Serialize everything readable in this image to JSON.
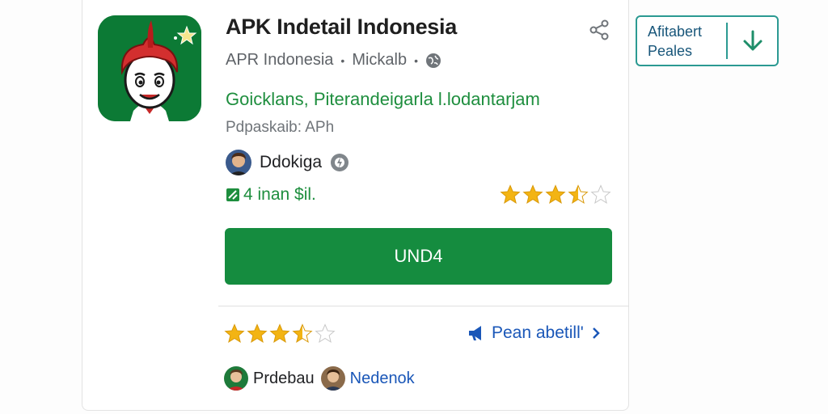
{
  "app": {
    "title": "APK Indetail Indonesia",
    "developer": "APR Indonesia",
    "developer_location": "Mickalb",
    "category": "Goicklans, Piterandeigarla l.lodantarjam",
    "package": "Pdpaskaib: APh",
    "author": "Ddokiga",
    "installs": "4 inan $il.",
    "rating_stars": 3.5,
    "install_button_label": "UND4"
  },
  "reviews": {
    "rating_stars": 3.5,
    "read_link_label": "Pean abetill'",
    "reviewers": [
      {
        "name": "Prdebau"
      },
      {
        "name": "Nedenok"
      }
    ]
  },
  "side_panel": {
    "line1": "Afitabert",
    "line2": "Peales"
  },
  "icons": {
    "share": "share-icon",
    "globe": "globe-icon",
    "verify": "verified-icon",
    "installs": "installs-icon",
    "star": "star-icon",
    "megaphone": "megaphone-icon",
    "chevron": "chevron-right-icon",
    "download": "download-arrow-icon"
  },
  "colors": {
    "app_icon_bg": "#0c7a35",
    "install_button": "#158c3f",
    "category_text": "#1e8e3e",
    "link_blue": "#1a57b8",
    "star_gold": "#f3b413",
    "side_border": "#2b9a92"
  }
}
